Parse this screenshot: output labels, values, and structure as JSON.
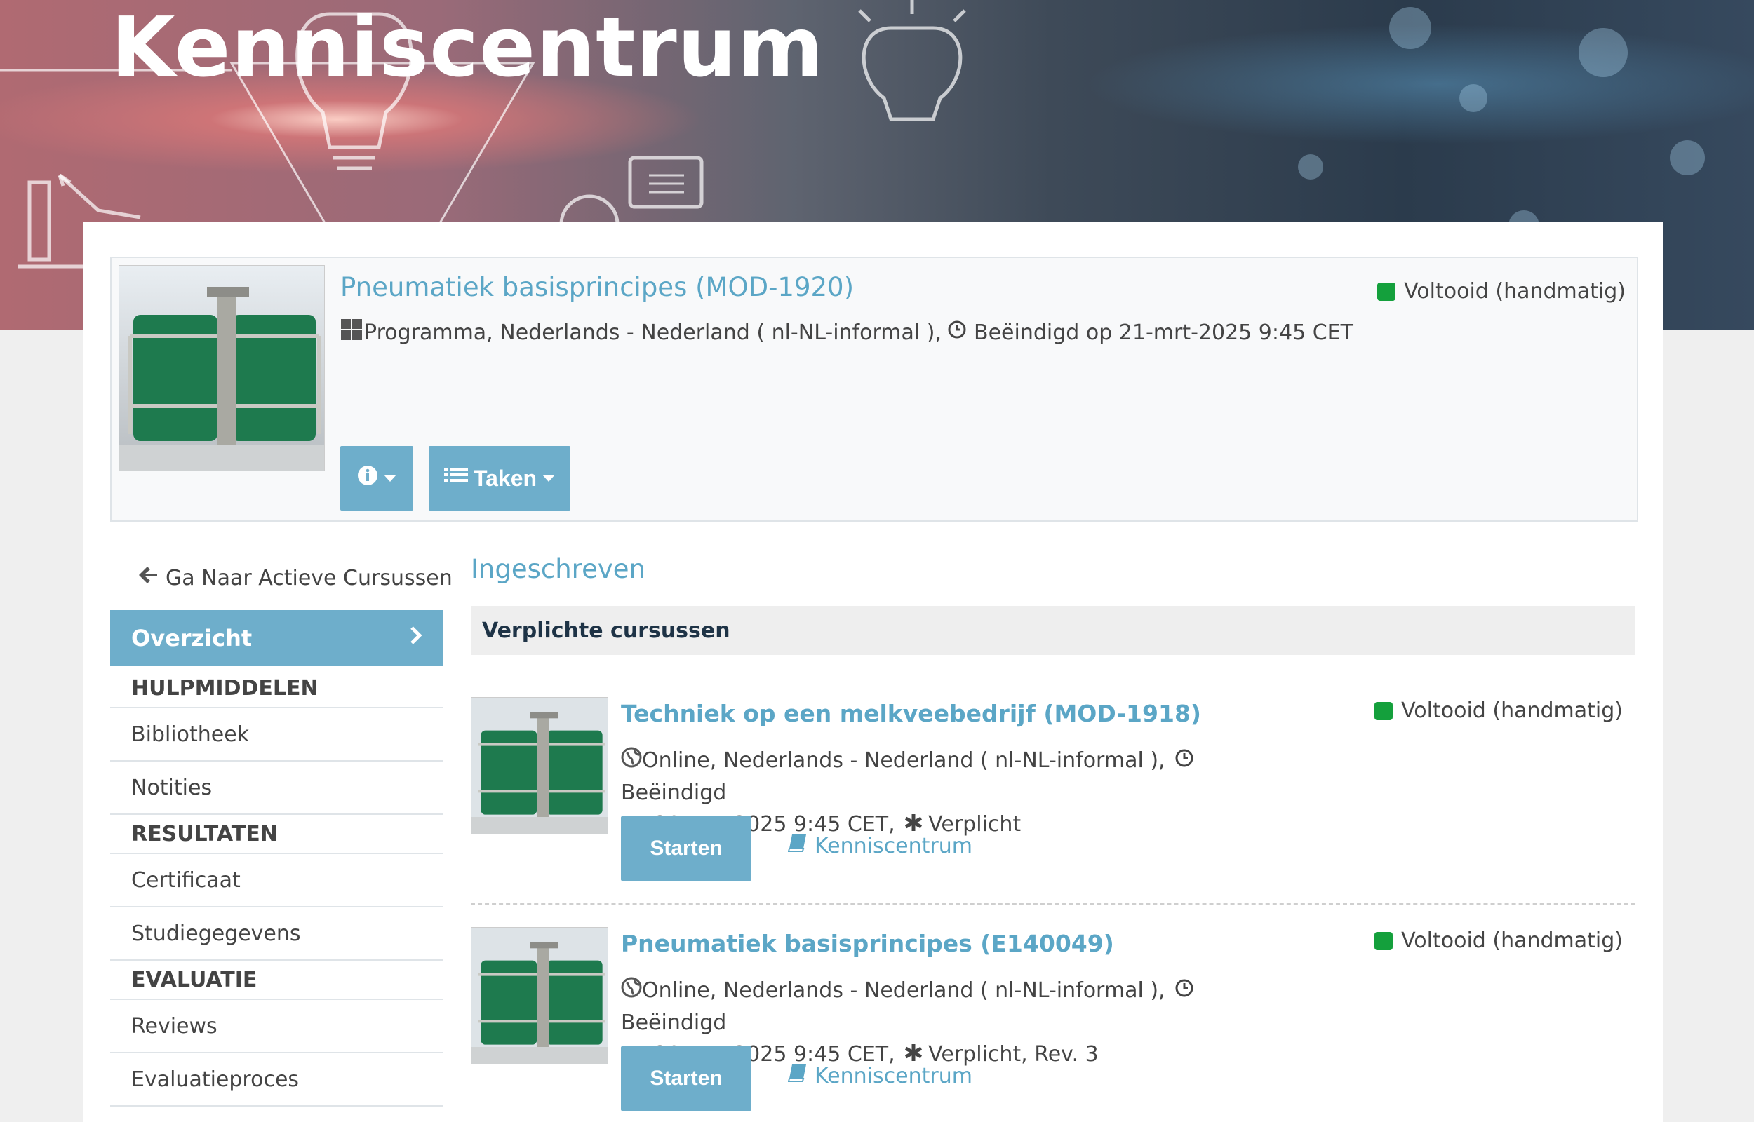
{
  "banner": {
    "title": "Kenniscentrum"
  },
  "program": {
    "title": "Pneumatiek basisprincipes (MOD-1920)",
    "meta": "Programma, Nederlands - Nederland ( nl-NL-informal ), ",
    "ended": "Beëindigd op 21-mrt-2025 9:45 CET",
    "status": "Voltooid (handmatig)",
    "info_icon": "info-icon",
    "tasks_label": "Taken"
  },
  "sidebar": {
    "back_label": "Ga Naar Actieve Cursussen",
    "active_item": "Overzicht",
    "sections": [
      {
        "heading": "HULPMIDDELEN",
        "items": [
          "Bibliotheek",
          "Notities"
        ]
      },
      {
        "heading": "RESULTATEN",
        "items": [
          "Certificaat",
          "Studiegegevens"
        ]
      },
      {
        "heading": "EVALUATIE",
        "items": [
          "Reviews",
          "Evaluatieproces"
        ]
      }
    ]
  },
  "content": {
    "enrolled_title": "Ingeschreven",
    "required_heading": "Verplichte cursussen",
    "courses": [
      {
        "title": "Techniek op een melkveebedrijf (MOD-1918)",
        "meta_line1": "Online, Nederlands - Nederland ( nl-NL-informal ), ",
        "ended_part1": "Beëindigd",
        "meta_line2": "op 21-mrt-2025 9:45 CET, ",
        "required": "Verplicht",
        "status": "Voltooid (handmatig)",
        "start_label": "Starten",
        "link_label": "Kenniscentrum"
      },
      {
        "title": "Pneumatiek basisprincipes (E140049)",
        "meta_line1": "Online, Nederlands - Nederland ( nl-NL-informal ), ",
        "ended_part1": "Beëindigd",
        "meta_line2": "op 21-mrt-2025 9:45 CET, ",
        "required": "Verplicht, Rev. 3",
        "status": "Voltooid (handmatig)",
        "start_label": "Starten",
        "link_label": "Kenniscentrum"
      }
    ]
  },
  "colors": {
    "accent": "#6eaecb",
    "link": "#5ba6c6",
    "status_green": "#14a03c"
  }
}
